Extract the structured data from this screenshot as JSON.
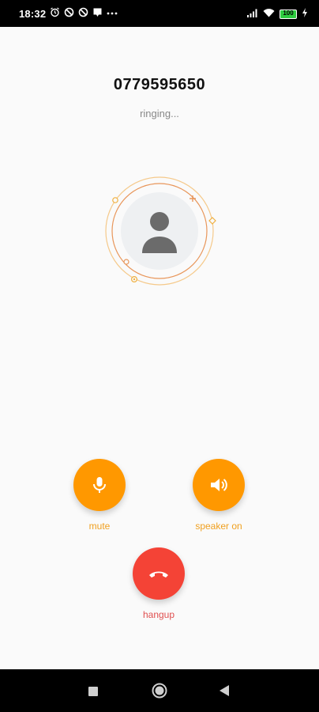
{
  "status_bar": {
    "time": "18:32",
    "battery": "100",
    "icons_left": [
      "alarm-icon",
      "blocked-icon",
      "blocked-icon",
      "notification-icon",
      "more-dots-icon"
    ],
    "icons_right": [
      "signal-icon",
      "wifi-icon",
      "battery-icon",
      "charging-icon"
    ]
  },
  "call": {
    "number": "0779595650",
    "status": "ringing..."
  },
  "actions": {
    "mute": "mute",
    "speaker": "speaker on",
    "hangup": "hangup"
  },
  "colors": {
    "accent": "#ff9800",
    "hangup": "#f44336",
    "ring": "#f0b040"
  },
  "nav": {
    "items": [
      "recents-square-icon",
      "home-circle-icon",
      "back-triangle-icon"
    ]
  }
}
